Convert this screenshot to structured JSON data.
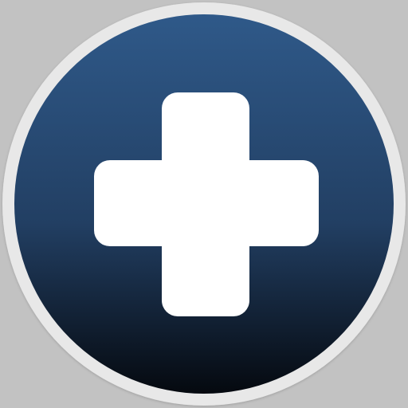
{
  "icon": {
    "name": "plus-icon",
    "colors": {
      "background": "#c2c2c2",
      "ring": "#e8e8e8",
      "gradient_top": "#2f5989",
      "gradient_mid": "#223f63",
      "gradient_bottom": "#05090f",
      "symbol": "#ffffff"
    }
  }
}
